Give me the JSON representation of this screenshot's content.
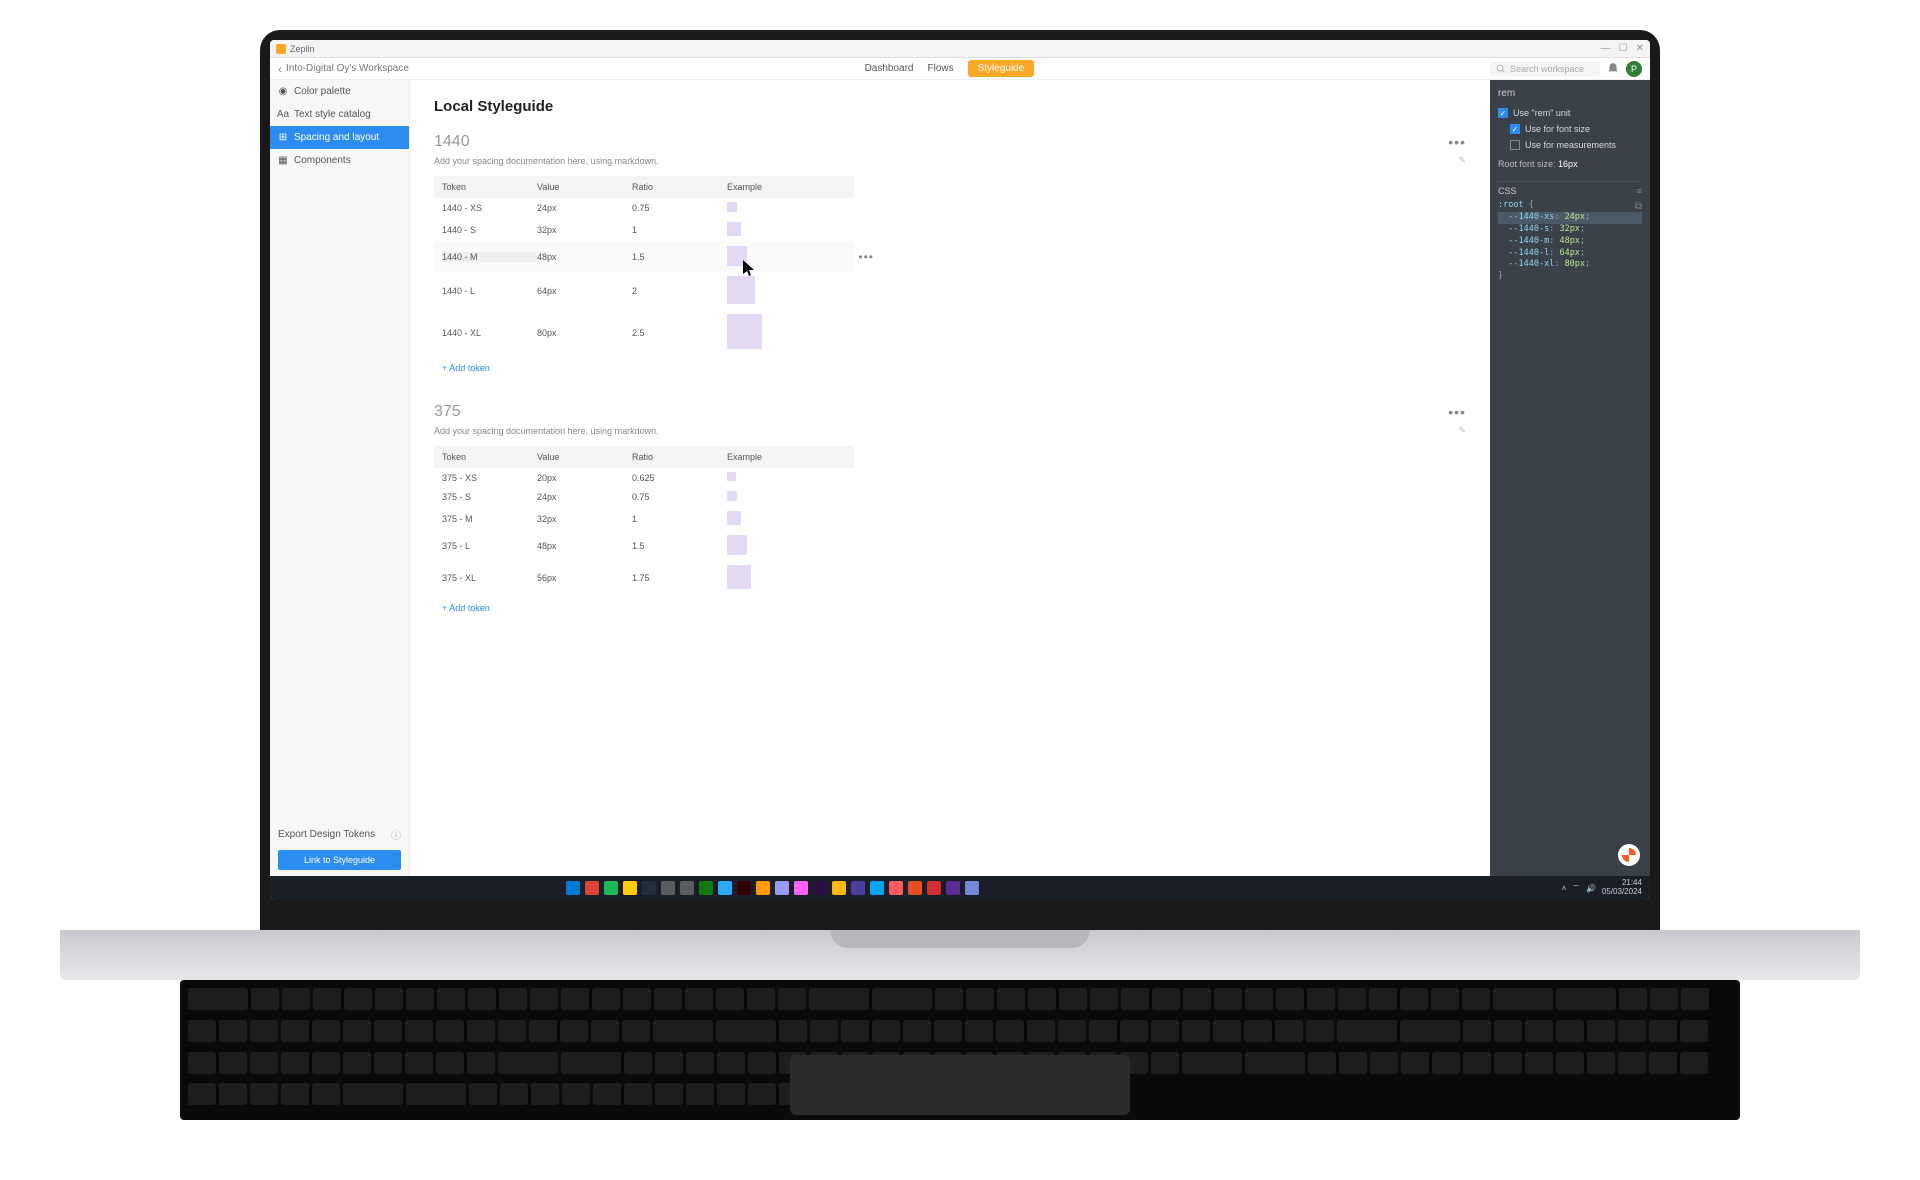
{
  "titlebar": {
    "app_name": "Zeplin"
  },
  "topnav": {
    "workspace": "Into-Digital Oy's Workspace",
    "dashboard": "Dashboard",
    "flows": "Flows",
    "styleguide": "Styleguide",
    "search_placeholder": "Search workspace",
    "avatar_initial": "P"
  },
  "sidebar": {
    "items": [
      {
        "label": "Color palette",
        "icon": "palette"
      },
      {
        "label": "Text style catalog",
        "icon": "text"
      },
      {
        "label": "Spacing and layout",
        "icon": "spacing",
        "active": true
      },
      {
        "label": "Components",
        "icon": "components"
      }
    ],
    "export": "Export Design Tokens",
    "link_btn": "Link to Styleguide"
  },
  "page_title": "Local Styleguide",
  "sections": [
    {
      "title": "1440",
      "desc": "Add your spacing documentation here, using markdown.",
      "headers": [
        "Token",
        "Value",
        "Ratio",
        "Example"
      ],
      "rows": [
        {
          "token": "1440 - XS",
          "value": "24px",
          "ratio": "0.75",
          "size": 10
        },
        {
          "token": "1440 - S",
          "value": "32px",
          "ratio": "1",
          "size": 14
        },
        {
          "token": "1440 - M",
          "value": "48px",
          "ratio": "1.5",
          "size": 20,
          "hover": true
        },
        {
          "token": "1440 - L",
          "value": "64px",
          "ratio": "2",
          "size": 28
        },
        {
          "token": "1440 - XL",
          "value": "80px",
          "ratio": "2.5",
          "size": 35
        }
      ],
      "add": "+ Add token"
    },
    {
      "title": "375",
      "desc": "Add your spacing documentation here, using markdown.",
      "headers": [
        "Token",
        "Value",
        "Ratio",
        "Example"
      ],
      "rows": [
        {
          "token": "375 - XS",
          "value": "20px",
          "ratio": "0.625",
          "size": 9
        },
        {
          "token": "375 - S",
          "value": "24px",
          "ratio": "0.75",
          "size": 10
        },
        {
          "token": "375 - M",
          "value": "32px",
          "ratio": "1",
          "size": 14
        },
        {
          "token": "375 - L",
          "value": "48px",
          "ratio": "1.5",
          "size": 20
        },
        {
          "token": "375 - XL",
          "value": "56px",
          "ratio": "1.75",
          "size": 24
        }
      ],
      "add": "+ Add token"
    }
  ],
  "rightpanel": {
    "title": "rem",
    "use_rem": "Use \"rem\" unit",
    "use_font": "Use for font size",
    "use_meas": "Use for measurements",
    "root_font_label": "Root font size:",
    "root_font_value": "16px",
    "lang": "CSS",
    "code_lines": [
      {
        "sel": ":root",
        "plain": " {"
      },
      {
        "prop": "--1440-xs",
        "val": "24px",
        "hl": true
      },
      {
        "prop": "--1440-s",
        "val": "32px"
      },
      {
        "prop": "--1440-m",
        "val": "48px"
      },
      {
        "prop": "--1440-l",
        "val": "64px"
      },
      {
        "prop": "--1440-xl",
        "val": "80px"
      },
      {
        "plain": "}"
      }
    ]
  },
  "taskbar": {
    "time": "21:44",
    "date": "05/03/2024",
    "icons": [
      "#0078d4",
      "#db4437",
      "#1db954",
      "#ffcd00",
      "#232f3e",
      "#5c5c5c",
      "#5c5c5c",
      "#107c10",
      "#31a8ff",
      "#330000",
      "#ff9a00",
      "#9999ff",
      "#ff61f6",
      "#2d0f3f",
      "#fdb813",
      "#4b3f9e",
      "#00a4ef",
      "#fd5c63",
      "#e44d26",
      "#d32f2f",
      "#5c2d91",
      "#7289da"
    ]
  }
}
